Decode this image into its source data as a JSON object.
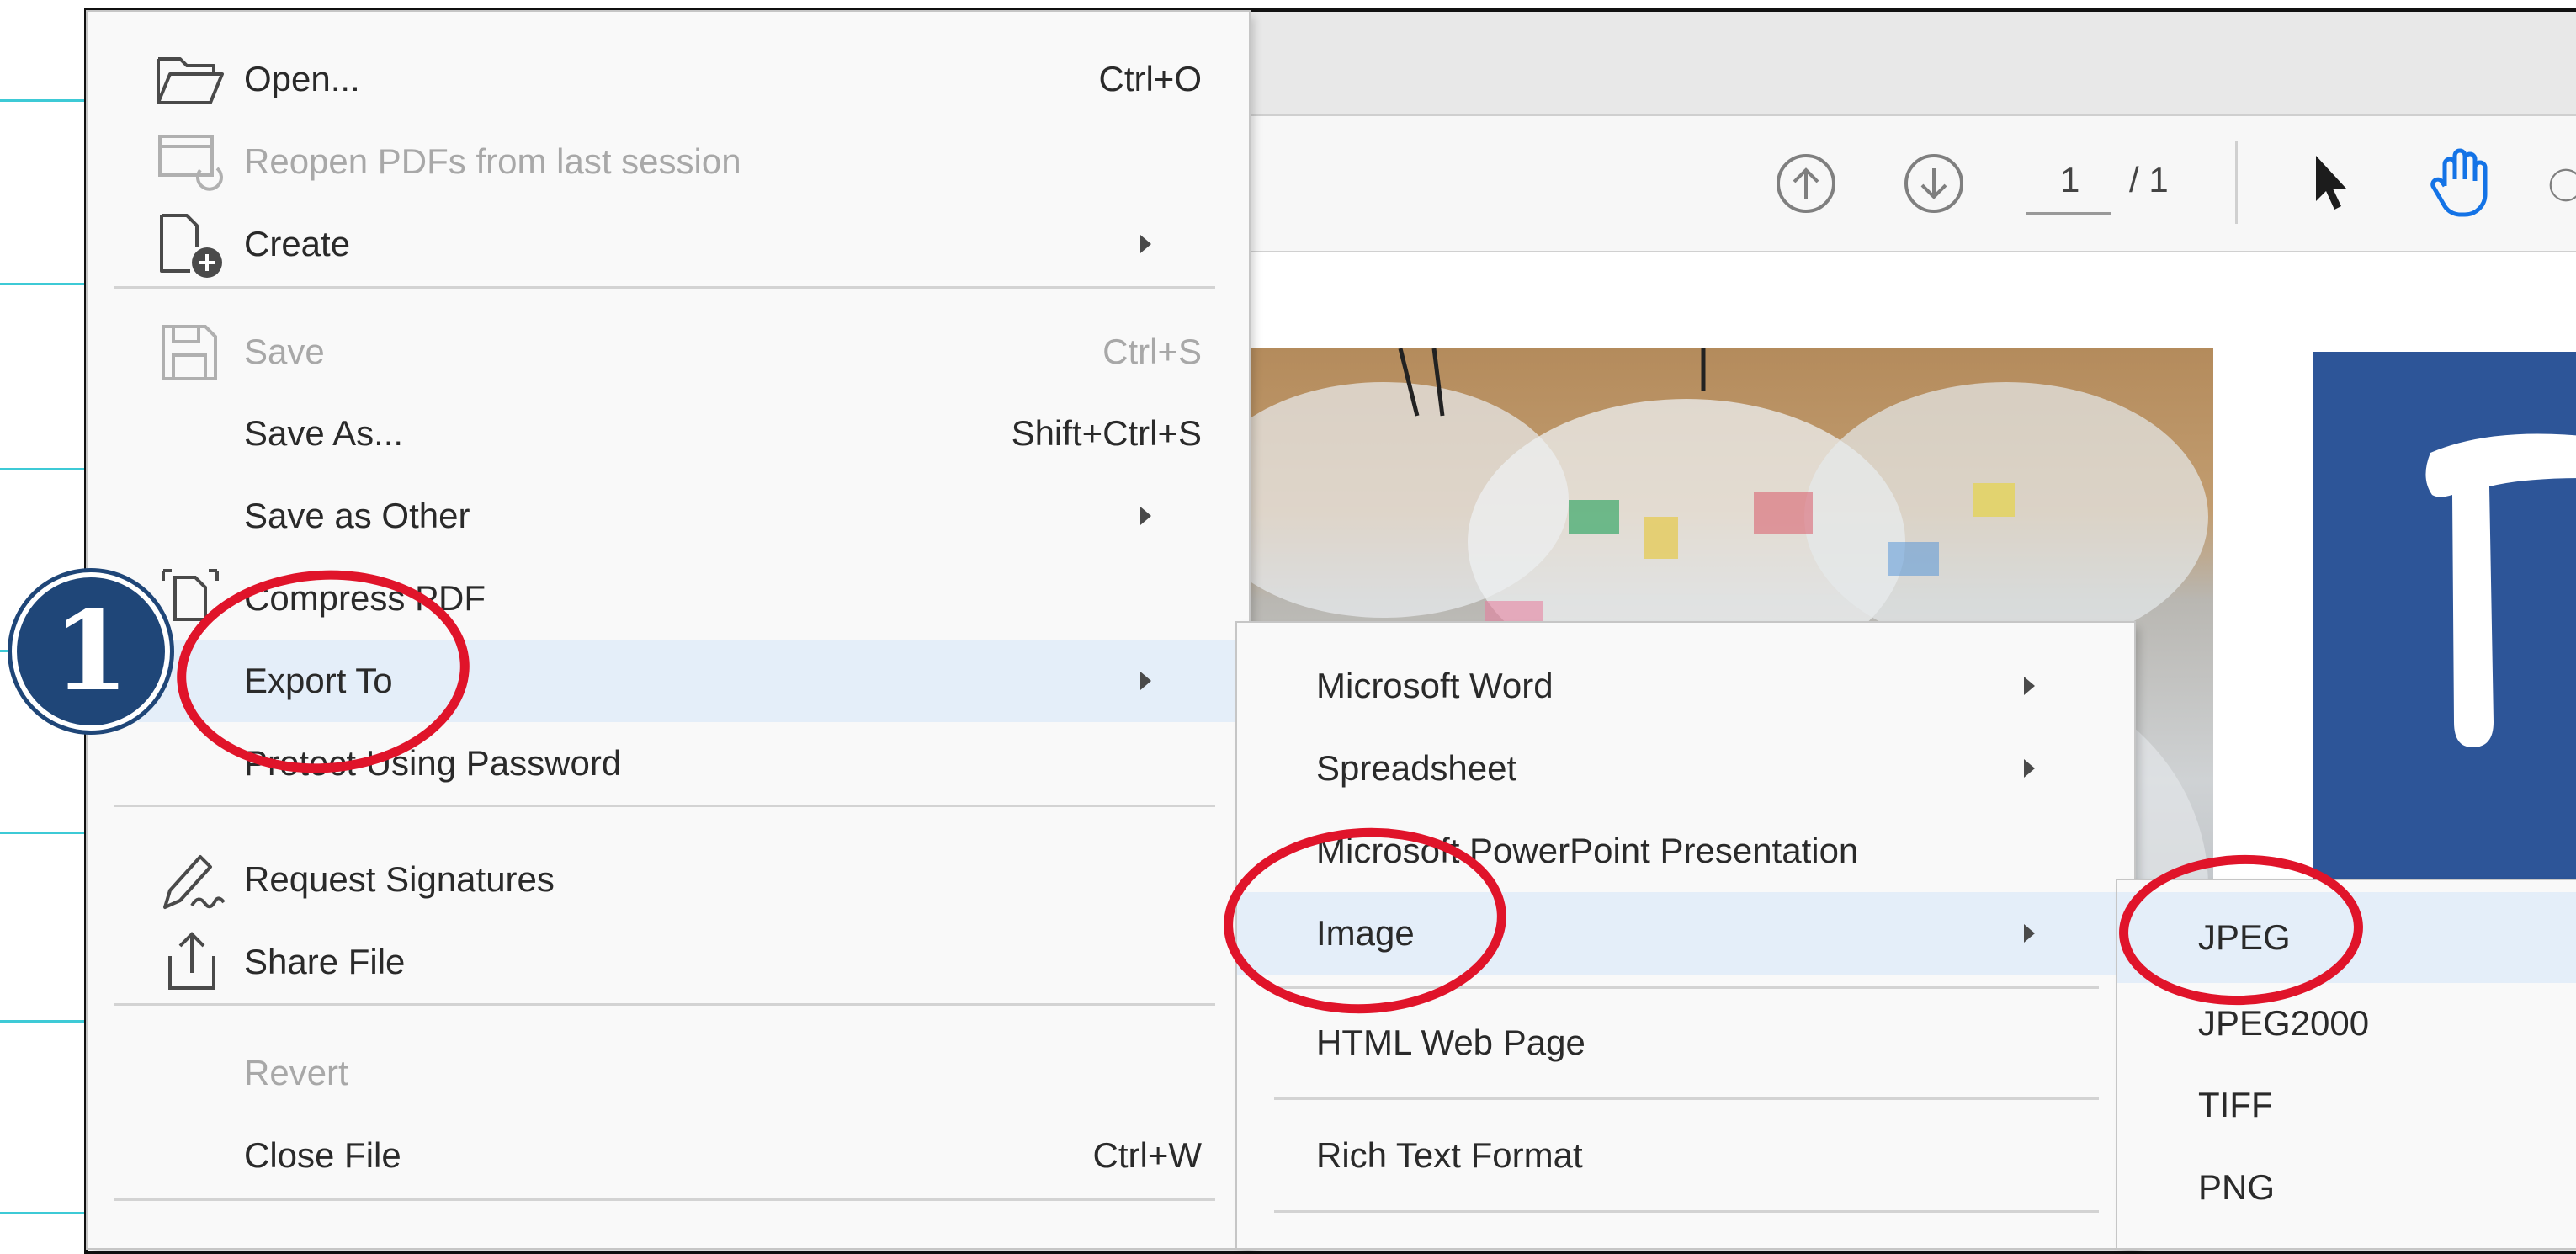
{
  "toolbar": {
    "page_current": "1",
    "page_total": "/ 1"
  },
  "file_menu": {
    "items": [
      {
        "label": "Open...",
        "shortcut": "Ctrl+O"
      },
      {
        "label": "Reopen PDFs from last session"
      },
      {
        "label": "Create"
      },
      {
        "label": "Save",
        "shortcut": "Ctrl+S"
      },
      {
        "label": "Save As...",
        "shortcut": "Shift+Ctrl+S"
      },
      {
        "label": "Save as Other"
      },
      {
        "label": "Compress PDF"
      },
      {
        "label": "Export To"
      },
      {
        "label": "Protect Using Password"
      },
      {
        "label": "Request Signatures"
      },
      {
        "label": "Share File"
      },
      {
        "label": "Revert"
      },
      {
        "label": "Close File",
        "shortcut": "Ctrl+W"
      }
    ]
  },
  "export_submenu": {
    "items": [
      {
        "label": "Microsoft Word"
      },
      {
        "label": "Spreadsheet"
      },
      {
        "label": "Microsoft PowerPoint Presentation"
      },
      {
        "label": "Image"
      },
      {
        "label": "HTML Web Page"
      },
      {
        "label": "Rich Text Format"
      }
    ]
  },
  "image_submenu": {
    "items": [
      {
        "label": "JPEG"
      },
      {
        "label": "JPEG2000"
      },
      {
        "label": "TIFF"
      },
      {
        "label": "PNG"
      }
    ]
  },
  "annotation": {
    "step_number": "1"
  },
  "colors": {
    "highlight": "#e4eef9",
    "annotation_red": "#e0142a",
    "badge_blue": "#1f4678",
    "accent_blue": "#1473e6"
  }
}
